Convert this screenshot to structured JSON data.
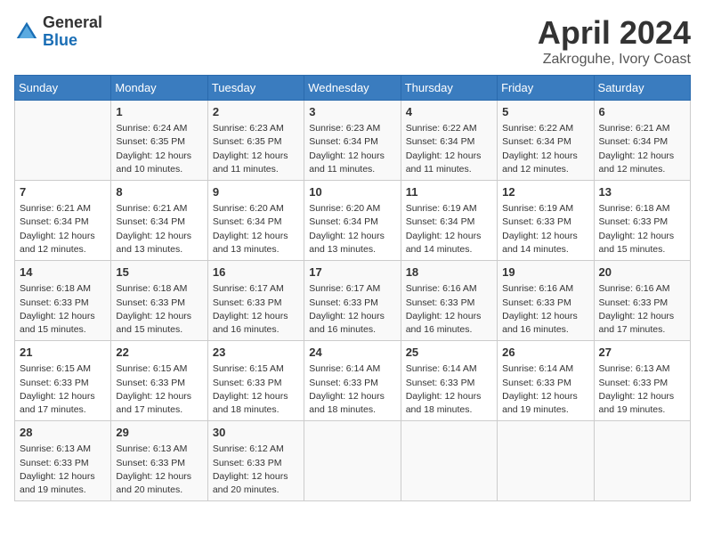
{
  "header": {
    "logo_general": "General",
    "logo_blue": "Blue",
    "title": "April 2024",
    "subtitle": "Zakroguhe, Ivory Coast"
  },
  "columns": [
    "Sunday",
    "Monday",
    "Tuesday",
    "Wednesday",
    "Thursday",
    "Friday",
    "Saturday"
  ],
  "weeks": [
    [
      {
        "day": "",
        "content": ""
      },
      {
        "day": "1",
        "content": "Sunrise: 6:24 AM\nSunset: 6:35 PM\nDaylight: 12 hours\nand 10 minutes."
      },
      {
        "day": "2",
        "content": "Sunrise: 6:23 AM\nSunset: 6:35 PM\nDaylight: 12 hours\nand 11 minutes."
      },
      {
        "day": "3",
        "content": "Sunrise: 6:23 AM\nSunset: 6:34 PM\nDaylight: 12 hours\nand 11 minutes."
      },
      {
        "day": "4",
        "content": "Sunrise: 6:22 AM\nSunset: 6:34 PM\nDaylight: 12 hours\nand 11 minutes."
      },
      {
        "day": "5",
        "content": "Sunrise: 6:22 AM\nSunset: 6:34 PM\nDaylight: 12 hours\nand 12 minutes."
      },
      {
        "day": "6",
        "content": "Sunrise: 6:21 AM\nSunset: 6:34 PM\nDaylight: 12 hours\nand 12 minutes."
      }
    ],
    [
      {
        "day": "7",
        "content": "Sunrise: 6:21 AM\nSunset: 6:34 PM\nDaylight: 12 hours\nand 12 minutes."
      },
      {
        "day": "8",
        "content": "Sunrise: 6:21 AM\nSunset: 6:34 PM\nDaylight: 12 hours\nand 13 minutes."
      },
      {
        "day": "9",
        "content": "Sunrise: 6:20 AM\nSunset: 6:34 PM\nDaylight: 12 hours\nand 13 minutes."
      },
      {
        "day": "10",
        "content": "Sunrise: 6:20 AM\nSunset: 6:34 PM\nDaylight: 12 hours\nand 13 minutes."
      },
      {
        "day": "11",
        "content": "Sunrise: 6:19 AM\nSunset: 6:34 PM\nDaylight: 12 hours\nand 14 minutes."
      },
      {
        "day": "12",
        "content": "Sunrise: 6:19 AM\nSunset: 6:33 PM\nDaylight: 12 hours\nand 14 minutes."
      },
      {
        "day": "13",
        "content": "Sunrise: 6:18 AM\nSunset: 6:33 PM\nDaylight: 12 hours\nand 15 minutes."
      }
    ],
    [
      {
        "day": "14",
        "content": "Sunrise: 6:18 AM\nSunset: 6:33 PM\nDaylight: 12 hours\nand 15 minutes."
      },
      {
        "day": "15",
        "content": "Sunrise: 6:18 AM\nSunset: 6:33 PM\nDaylight: 12 hours\nand 15 minutes."
      },
      {
        "day": "16",
        "content": "Sunrise: 6:17 AM\nSunset: 6:33 PM\nDaylight: 12 hours\nand 16 minutes."
      },
      {
        "day": "17",
        "content": "Sunrise: 6:17 AM\nSunset: 6:33 PM\nDaylight: 12 hours\nand 16 minutes."
      },
      {
        "day": "18",
        "content": "Sunrise: 6:16 AM\nSunset: 6:33 PM\nDaylight: 12 hours\nand 16 minutes."
      },
      {
        "day": "19",
        "content": "Sunrise: 6:16 AM\nSunset: 6:33 PM\nDaylight: 12 hours\nand 16 minutes."
      },
      {
        "day": "20",
        "content": "Sunrise: 6:16 AM\nSunset: 6:33 PM\nDaylight: 12 hours\nand 17 minutes."
      }
    ],
    [
      {
        "day": "21",
        "content": "Sunrise: 6:15 AM\nSunset: 6:33 PM\nDaylight: 12 hours\nand 17 minutes."
      },
      {
        "day": "22",
        "content": "Sunrise: 6:15 AM\nSunset: 6:33 PM\nDaylight: 12 hours\nand 17 minutes."
      },
      {
        "day": "23",
        "content": "Sunrise: 6:15 AM\nSunset: 6:33 PM\nDaylight: 12 hours\nand 18 minutes."
      },
      {
        "day": "24",
        "content": "Sunrise: 6:14 AM\nSunset: 6:33 PM\nDaylight: 12 hours\nand 18 minutes."
      },
      {
        "day": "25",
        "content": "Sunrise: 6:14 AM\nSunset: 6:33 PM\nDaylight: 12 hours\nand 18 minutes."
      },
      {
        "day": "26",
        "content": "Sunrise: 6:14 AM\nSunset: 6:33 PM\nDaylight: 12 hours\nand 19 minutes."
      },
      {
        "day": "27",
        "content": "Sunrise: 6:13 AM\nSunset: 6:33 PM\nDaylight: 12 hours\nand 19 minutes."
      }
    ],
    [
      {
        "day": "28",
        "content": "Sunrise: 6:13 AM\nSunset: 6:33 PM\nDaylight: 12 hours\nand 19 minutes."
      },
      {
        "day": "29",
        "content": "Sunrise: 6:13 AM\nSunset: 6:33 PM\nDaylight: 12 hours\nand 20 minutes."
      },
      {
        "day": "30",
        "content": "Sunrise: 6:12 AM\nSunset: 6:33 PM\nDaylight: 12 hours\nand 20 minutes."
      },
      {
        "day": "",
        "content": ""
      },
      {
        "day": "",
        "content": ""
      },
      {
        "day": "",
        "content": ""
      },
      {
        "day": "",
        "content": ""
      }
    ]
  ]
}
